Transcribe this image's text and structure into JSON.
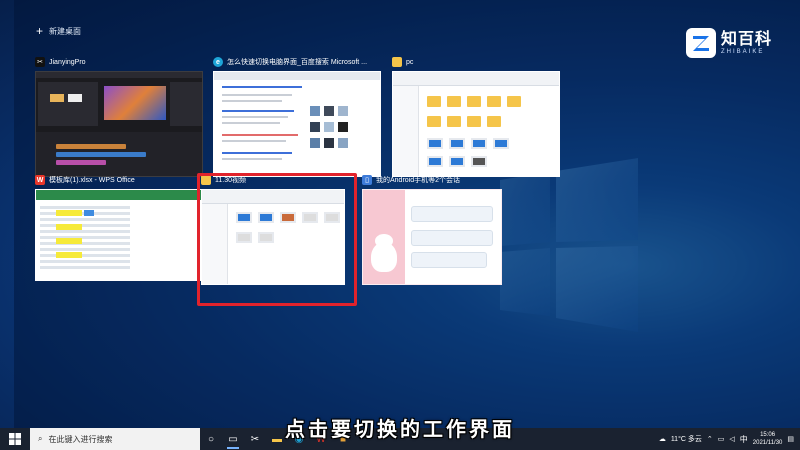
{
  "task_view": {
    "new_desktop_label": "新建桌面"
  },
  "brand": {
    "name_cn": "知百科",
    "name_en": "ZHIBAIKE"
  },
  "windows": [
    {
      "title": "JianyingPro",
      "icon": "capcut-icon"
    },
    {
      "title": "怎么快速切换电脑界面_百度搜索 Microsoft ...",
      "icon": "edge-icon"
    },
    {
      "title": "pc",
      "icon": "folder-icon"
    },
    {
      "title": "模板库(1).xlsx - WPS Office",
      "icon": "wps-icon"
    },
    {
      "title": "11.30视频",
      "icon": "folder-icon",
      "selected": true
    },
    {
      "title": "我的Android手机等2个会话",
      "icon": "phone-icon"
    }
  ],
  "subtitle": "点击要切换的工作界面",
  "taskbar": {
    "search_placeholder": "在此键入进行搜索",
    "weather": "11°C 多云",
    "ime": "中",
    "time": "15:06",
    "date": "2021/11/30"
  },
  "colors": {
    "highlight": "#e1232c",
    "taskbar": "#1a2230",
    "folder": "#f5c54a"
  }
}
